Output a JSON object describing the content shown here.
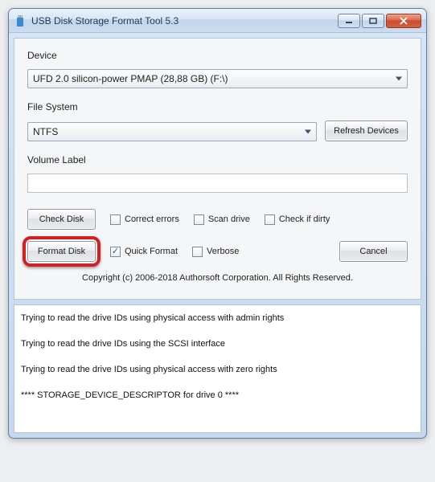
{
  "window": {
    "title": "USB Disk Storage Format Tool 5.3"
  },
  "labels": {
    "device": "Device",
    "filesystem": "File System",
    "volume_label": "Volume Label"
  },
  "device": {
    "selected": "UFD 2.0  silicon-power  PMAP (28,88 GB) (F:\\)"
  },
  "filesystem": {
    "selected": "NTFS"
  },
  "volume_label_value": "",
  "buttons": {
    "refresh": "Refresh Devices",
    "check_disk": "Check Disk",
    "format_disk": "Format Disk",
    "cancel": "Cancel"
  },
  "checkrow": {
    "correct_errors": "Correct errors",
    "scan_drive": "Scan drive",
    "check_if_dirty": "Check if dirty"
  },
  "formatrow": {
    "quick_format": "Quick Format",
    "quick_format_checked": true,
    "verbose": "Verbose"
  },
  "copyright": "Copyright (c) 2006-2018 Authorsoft Corporation. All Rights Reserved.",
  "log_lines": [
    "Trying to read the drive IDs using physical access with admin rights",
    "Trying to read the drive IDs using the SCSI interface",
    "Trying to read the drive IDs using physical access with zero rights",
    "**** STORAGE_DEVICE_DESCRIPTOR for drive 0 ****"
  ]
}
